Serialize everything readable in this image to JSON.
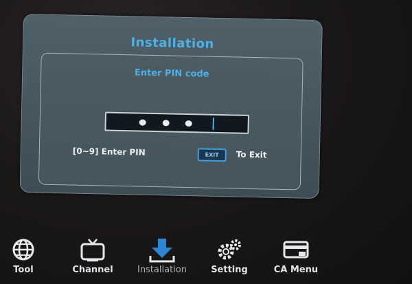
{
  "dialog": {
    "title": "Installation",
    "prompt": "Enter PIN code",
    "pin_dots_entered": 3,
    "hint_enter": "[0~9] Enter PIN",
    "exit_key_label": "EXIT",
    "hint_exit": "To Exit"
  },
  "menu": {
    "items": [
      {
        "label": "Tool",
        "icon": "globe-icon"
      },
      {
        "label": "Channel",
        "icon": "tv-icon"
      },
      {
        "label": "Installation",
        "icon": "download-icon",
        "active": true
      },
      {
        "label": "Setting",
        "icon": "gears-icon"
      },
      {
        "label": "CA Menu",
        "icon": "card-icon"
      }
    ]
  },
  "colors": {
    "accent": "#4fb0e8",
    "dialog_bg": "#485860",
    "active_icon": "#2f86d6"
  }
}
